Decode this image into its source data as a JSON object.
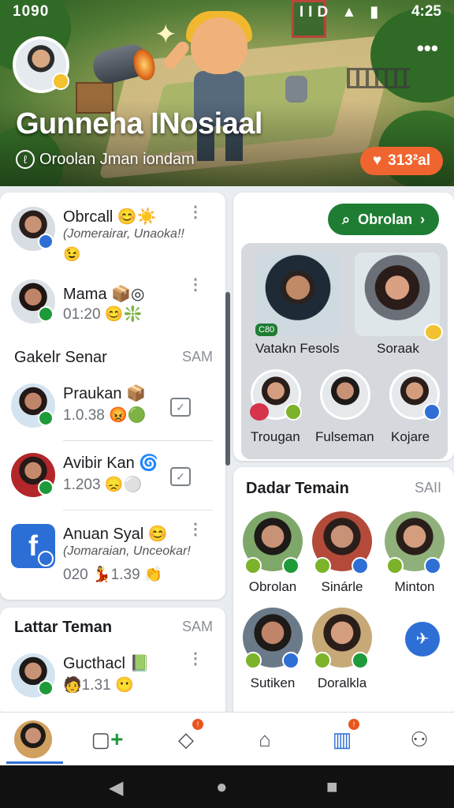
{
  "status_bar": {
    "left": "1090",
    "icons": "ⓢ æ 6 ■",
    "right_icons": "IID ▲ ▮",
    "time": "4:25"
  },
  "header": {
    "title": "Gunneha INosiaal",
    "subtitle": "Oroolan Jman iondam",
    "like_count": "313²al",
    "more": "•••"
  },
  "chats": {
    "items": [
      {
        "name": "Obrcall",
        "emoji": "😊☀️",
        "message": "(Jomerairar, Unaoka!!",
        "reaction": "😉"
      },
      {
        "name": "Mama",
        "emoji": "📦◎",
        "time": "01:20",
        "reaction": "😊❇️"
      }
    ]
  },
  "gakelr": {
    "title": "Gakelr Senar",
    "more": "SAM",
    "items": [
      {
        "name": "Praukan",
        "emoji": "📦",
        "time": "1.0.38",
        "reaction": "😡🟢"
      },
      {
        "name": "Avibir Kan",
        "emoji": "🌀",
        "time": "1.203",
        "reaction": "😞⚪"
      },
      {
        "name": "Anuan Syal",
        "emoji": "😊",
        "message": "(Jomaraian, Unceokar!",
        "time": "020",
        "reaction": "💃",
        "time2": "1.39",
        "tail": "👏"
      }
    ]
  },
  "lattar": {
    "title": "Lattar Teman",
    "more": "SAM",
    "items": [
      {
        "name": "Gucthacl",
        "emoji": "📗",
        "time": "1.31",
        "pre": "🧑",
        "reaction": "😶"
      }
    ]
  },
  "obrolan_button": "Obrolan",
  "video": {
    "tiles": [
      {
        "name": "Vatakn Fesols",
        "tag": "C80"
      },
      {
        "name": "Soraak"
      }
    ],
    "circles": [
      {
        "name": "Trougan"
      },
      {
        "name": "Fulseman"
      },
      {
        "name": "Kojare"
      }
    ]
  },
  "dadar": {
    "title": "Dadar Temain",
    "more": "SAII",
    "friends": [
      {
        "name": "Obrolan"
      },
      {
        "name": "Sinárle"
      },
      {
        "name": "Minton"
      },
      {
        "name": "Sutiken"
      },
      {
        "name": "Doralkla"
      }
    ]
  },
  "colors": {
    "accent": "#1e7d32",
    "like": "#f0652f",
    "verified": "#2e6fd6"
  },
  "nav": [
    "profile",
    "add-task-icon",
    "box-icon",
    "home-icon",
    "board-icon",
    "person-icon"
  ]
}
